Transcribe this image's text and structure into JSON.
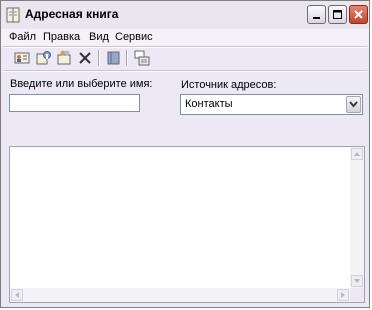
{
  "window": {
    "title": "Адресная книга"
  },
  "menu": {
    "items": [
      "Файл",
      "Правка",
      "Вид",
      "Сервис"
    ]
  },
  "toolbar": {
    "icons": [
      "new-contact-icon",
      "properties-icon",
      "find-people-icon",
      "delete-icon",
      "book-icon",
      "action-icon"
    ]
  },
  "form": {
    "search_label": "Введите или выберите имя:",
    "search_value": "",
    "source_label": "Источник адресов:",
    "source_value": "Контакты"
  },
  "colors": {
    "window_bg": "#ece9f5",
    "close_button": "#c7432c",
    "field_border": "#7a8fb7"
  }
}
